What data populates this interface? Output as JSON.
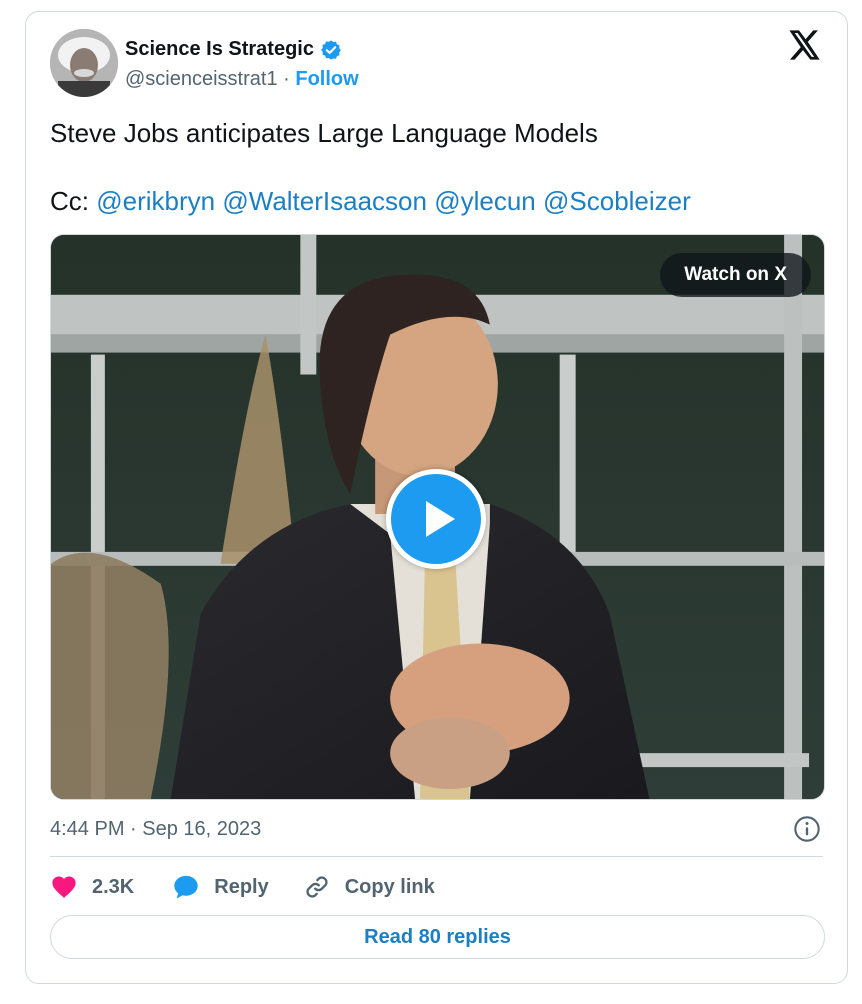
{
  "author": {
    "name": "Science Is Strategic",
    "handle": "@scienceisstrat1",
    "separator": " · ",
    "follow_label": "Follow"
  },
  "tweet": {
    "text": "Steve Jobs anticipates Large Language Models",
    "cc_prefix": "Cc: ",
    "mentions": [
      "@erikbryn",
      "@WalterIsaacson",
      "@ylecun",
      "@Scobleizer"
    ]
  },
  "media": {
    "watch_label": "Watch on X"
  },
  "meta": {
    "timestamp": "4:44 PM · Sep 16, 2023"
  },
  "actions": {
    "likes": "2.3K",
    "reply_label": "Reply",
    "copy_label": "Copy link"
  },
  "footer": {
    "read_replies_label": "Read 80 replies"
  },
  "icons": {
    "verified": "verified-badge-icon",
    "logo": "x-logo-icon",
    "play": "play-icon",
    "info": "info-icon",
    "like": "heart-icon",
    "reply": "speech-bubble-icon",
    "copy": "link-icon"
  },
  "colors": {
    "accent": "#1d9bf0",
    "link": "#1d7fc2",
    "like": "#f91880",
    "muted": "#536471"
  }
}
